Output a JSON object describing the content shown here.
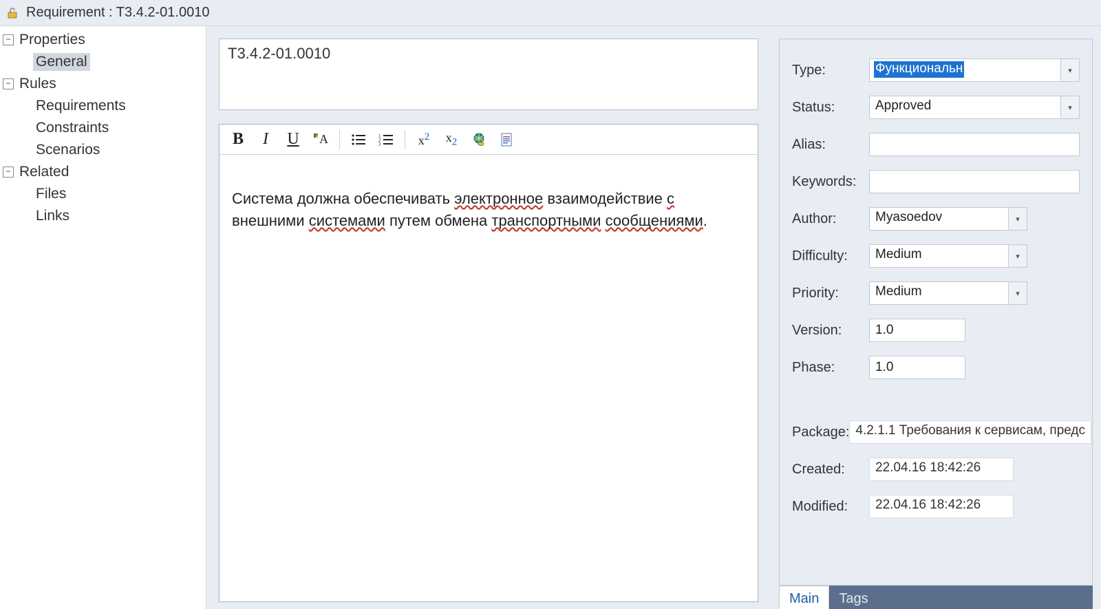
{
  "title": "Requirement : T3.4.2-01.0010",
  "tree": {
    "properties": "Properties",
    "general": "General",
    "rules": "Rules",
    "requirements": "Requirements",
    "constraints": "Constraints",
    "scenarios": "Scenarios",
    "related": "Related",
    "files": "Files",
    "links": "Links"
  },
  "name": "T3.4.2-01.0010",
  "description": {
    "parts": [
      {
        "t": "Система должна обеспечивать "
      },
      {
        "t": "электронное",
        "spell": true
      },
      {
        "t": " взаимодействие "
      },
      {
        "t": "с",
        "spell": true
      },
      {
        "t": " внешними "
      },
      {
        "t": "системами",
        "spell": true
      },
      {
        "t": " путем обмена "
      },
      {
        "t": "транспортными",
        "spell": true
      },
      {
        "t": " "
      },
      {
        "t": "сообщениями",
        "spell": true
      },
      {
        "t": "."
      }
    ]
  },
  "labels": {
    "type": "Type:",
    "status": "Status:",
    "alias": "Alias:",
    "keywords": "Keywords:",
    "author": "Author:",
    "difficulty": "Difficulty:",
    "priority": "Priority:",
    "version": "Version:",
    "phase": "Phase:",
    "package": "Package:",
    "created": "Created:",
    "modified": "Modified:"
  },
  "values": {
    "type": "Функциональн",
    "status": "Approved",
    "alias": "",
    "keywords": "",
    "author": "Myasoedov",
    "difficulty": "Medium",
    "priority": "Medium",
    "version": "1.0",
    "phase": "1.0",
    "package": "4.2.1.1 Требования к сервисам, предс",
    "created": "22.04.16 18:42:26",
    "modified": "22.04.16 18:42:26"
  },
  "tabs": {
    "main": "Main",
    "tags": "Tags"
  },
  "icons": {
    "toolbar": {
      "bold": "B",
      "italic": "I",
      "underline": "U",
      "sup": "x",
      "sup2": "2",
      "sub": "x",
      "sub2": "2"
    }
  }
}
